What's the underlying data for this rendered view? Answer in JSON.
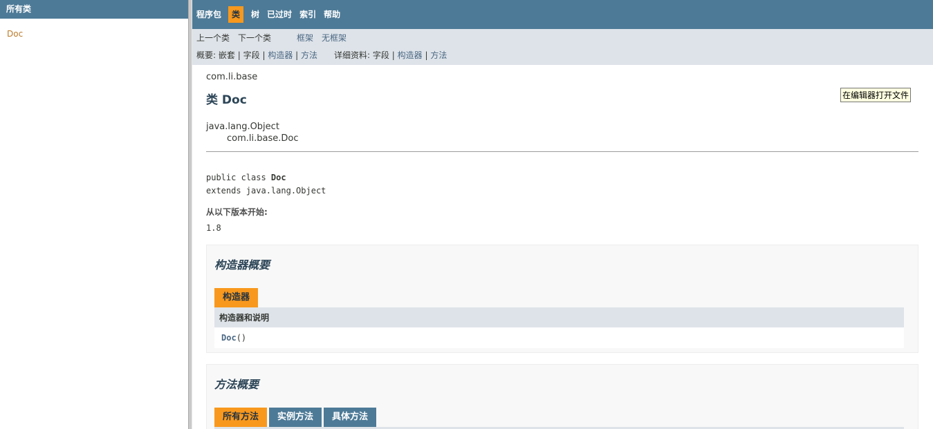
{
  "left": {
    "header": "所有类",
    "classes": [
      "Doc"
    ]
  },
  "nav": {
    "items": [
      "程序包",
      "类",
      "树",
      "已过时",
      "索引",
      "帮助"
    ],
    "active": "类"
  },
  "subnav": {
    "prev_class": "上一个类",
    "next_class": "下一个类",
    "frames": "框架",
    "no_frames": "无框架",
    "summary_label": "概要:",
    "summary_nested": "嵌套",
    "summary_field": "字段",
    "summary_constr": "构造器",
    "summary_method": "方法",
    "detail_label": "详细资料:",
    "detail_field": "字段",
    "detail_constr": "构造器",
    "detail_method": "方法",
    "sep": "|"
  },
  "tooltip": "在编辑器打开文件",
  "content": {
    "package": "com.li.base",
    "title": "类 Doc",
    "inherit_parent": "java.lang.Object",
    "inherit_child": "com.li.base.Doc",
    "sig_prefix": "public class ",
    "sig_name": "Doc",
    "sig_extends": "extends java.lang.Object",
    "since_label": "从以下版本开始:",
    "since_value": "1.8"
  },
  "constructor_summary": {
    "heading": "构造器概要",
    "tab": "构造器",
    "column": "构造器和说明",
    "row_name": "Doc",
    "row_args": "()"
  },
  "method_summary": {
    "heading": "方法概要",
    "tabs": [
      "所有方法",
      "实例方法",
      "具体方法"
    ]
  },
  "colors": {
    "nav_bg": "#4D7A97",
    "active_tab": "#F8981D",
    "subnav_bg": "#dee3e9",
    "link": "#4A6782",
    "left_link": "#bb7a2a"
  }
}
